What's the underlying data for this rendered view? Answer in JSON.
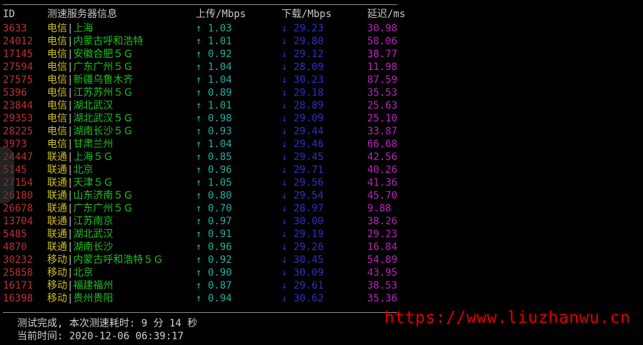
{
  "header": {
    "id": "ID",
    "server": "测速服务器信息",
    "upload": "上传/Mbps",
    "download": "下载/Mbps",
    "latency": "延迟/ms"
  },
  "up_arrow": "↑",
  "down_arrow": "↓",
  "separator": "|",
  "rows": [
    {
      "id": "3633",
      "isp": "电信",
      "loc": "上海",
      "up": "1.03",
      "down": "29.23",
      "lat": "30.98"
    },
    {
      "id": "24012",
      "isp": "电信",
      "loc": "内蒙古呼和浩特",
      "up": "1.01",
      "down": "29.80",
      "lat": "58.06"
    },
    {
      "id": "17145",
      "isp": "电信",
      "loc": "安徽合肥５Ｇ",
      "up": "0.92",
      "down": "29.12",
      "lat": "38.77"
    },
    {
      "id": "27594",
      "isp": "电信",
      "loc": "广东广州５Ｇ",
      "up": "1.04",
      "down": "28.09",
      "lat": "11.98"
    },
    {
      "id": "27575",
      "isp": "电信",
      "loc": "新疆乌鲁木齐",
      "up": "1.04",
      "down": "30.23",
      "lat": "87.59"
    },
    {
      "id": "5396",
      "isp": "电信",
      "loc": "江苏苏州５Ｇ",
      "up": "0.89",
      "down": "29.18",
      "lat": "35.53"
    },
    {
      "id": "23844",
      "isp": "电信",
      "loc": "湖北武汉",
      "up": "1.01",
      "down": "28.89",
      "lat": "25.63"
    },
    {
      "id": "29353",
      "isp": "电信",
      "loc": "湖北武汉５Ｇ",
      "up": "0.98",
      "down": "29.09",
      "lat": "25.10"
    },
    {
      "id": "28225",
      "isp": "电信",
      "loc": "湖南长沙５Ｇ",
      "up": "0.93",
      "down": "29.44",
      "lat": "33.87"
    },
    {
      "id": "3973",
      "isp": "电信",
      "loc": "甘肃兰州",
      "up": "1.04",
      "down": "29.46",
      "lat": "66.68"
    },
    {
      "id": "24447",
      "isp": "联通",
      "loc": "上海５Ｇ",
      "up": "0.85",
      "down": "29.45",
      "lat": "42.56"
    },
    {
      "id": "5145",
      "isp": "联通",
      "loc": "北京",
      "up": "0.96",
      "down": "29.71",
      "lat": "40.26"
    },
    {
      "id": "27154",
      "isp": "联通",
      "loc": "天津５Ｇ",
      "up": "1.05",
      "down": "29.56",
      "lat": "41.36"
    },
    {
      "id": "26180",
      "isp": "联通",
      "loc": "山东济南５Ｇ",
      "up": "0.80",
      "down": "29.54",
      "lat": "45.70"
    },
    {
      "id": "26678",
      "isp": "联通",
      "loc": "广东广州５Ｇ",
      "up": "0.70",
      "down": "28.97",
      "lat": "9.88"
    },
    {
      "id": "13704",
      "isp": "联通",
      "loc": "江苏南京",
      "up": "0.97",
      "down": "30.00",
      "lat": "38.26"
    },
    {
      "id": "5485",
      "isp": "联通",
      "loc": "湖北武汉",
      "up": "0.91",
      "down": "29.19",
      "lat": "29.23"
    },
    {
      "id": "4870",
      "isp": "联通",
      "loc": "湖南长沙",
      "up": "0.96",
      "down": "29.26",
      "lat": "16.84"
    },
    {
      "id": "30232",
      "isp": "移动",
      "loc": "内蒙古呼和浩特５Ｇ",
      "up": "0.92",
      "down": "30.45",
      "lat": "54.89"
    },
    {
      "id": "25858",
      "isp": "移动",
      "loc": "北京",
      "up": "0.90",
      "down": "30.09",
      "lat": "43.95"
    },
    {
      "id": "16171",
      "isp": "移动",
      "loc": "福建福州",
      "up": "0.87",
      "down": "29.61",
      "lat": "38.53"
    },
    {
      "id": "16398",
      "isp": "移动",
      "loc": "贵州贵阳",
      "up": "0.94",
      "down": "30.62",
      "lat": "35.36"
    }
  ],
  "footer": {
    "done": "测试完成, 本次测速耗时: 9 分 14 秒",
    "time": "当前时间: 2020-12-06 06:39:17"
  },
  "watermark": "https://www.liuzhanwu.cn",
  "colors": {
    "id": "#c03030",
    "isp": "#d0c020",
    "location": "#20c020",
    "upload": "#20b0a0",
    "download": "#3030c0",
    "latency": "#c020c0",
    "watermark": "#e00000"
  }
}
